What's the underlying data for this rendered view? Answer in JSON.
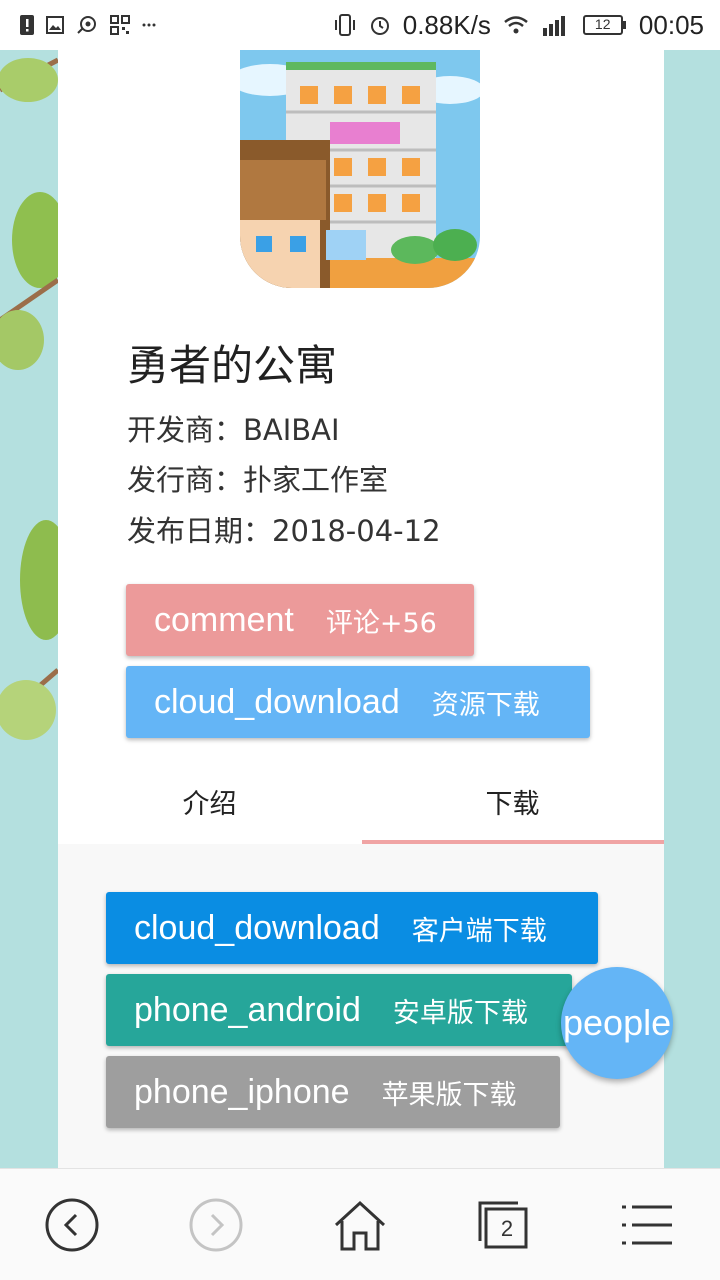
{
  "status_bar": {
    "speed": "0.88K/s",
    "battery": "12",
    "time": "00:05",
    "icons": [
      "alert-icon",
      "image-icon",
      "cast-icon",
      "qr-icon",
      "more-dots-icon",
      "vibrate-icon",
      "alarm-icon",
      "wifi-icon",
      "signal-icon",
      "battery-icon"
    ]
  },
  "app": {
    "title": "勇者的公寓",
    "developer": "开发商：BAIBAI",
    "publisher": "发行商：扑家工作室",
    "release_date": "发布日期：2018-04-12"
  },
  "actions": {
    "comment": {
      "icon": "comment",
      "label": "评论+56",
      "color": "#ec9a9a"
    },
    "resources": {
      "icon": "cloud_download",
      "label": "资源下载",
      "color": "#64b5f6"
    }
  },
  "tabs": [
    {
      "label": "介绍",
      "active": false
    },
    {
      "label": "下载",
      "active": true
    }
  ],
  "downloads": {
    "client": {
      "icon": "cloud_download",
      "label": "客户端下载",
      "color": "#0a8de3"
    },
    "android": {
      "icon": "phone_android",
      "label": "安卓版下载",
      "color": "#26a69a"
    },
    "iphone": {
      "icon": "phone_iphone",
      "label": "苹果版下载",
      "color": "#9e9e9e"
    }
  },
  "fab": {
    "icon": "people"
  },
  "bottom_nav": {
    "tab_count": "2",
    "items": [
      "back-icon",
      "forward-icon",
      "home-icon",
      "tabs-icon",
      "menu-icon"
    ]
  }
}
